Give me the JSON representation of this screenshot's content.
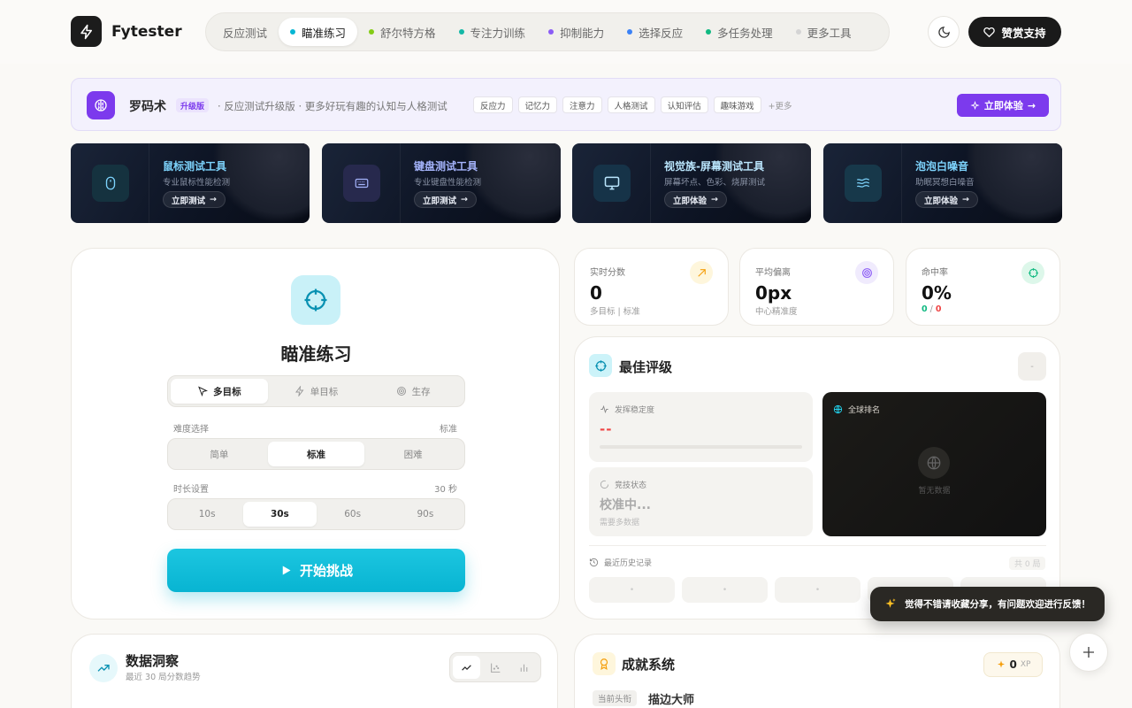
{
  "app": {
    "name": "Fytester"
  },
  "nav": [
    {
      "label": "反应测试",
      "dot": ""
    },
    {
      "label": "瞄准练习",
      "dot": "#06b6d4",
      "active": true
    },
    {
      "label": "舒尔特方格",
      "dot": "#84cc16"
    },
    {
      "label": "专注力训练",
      "dot": "#14b8a6"
    },
    {
      "label": "抑制能力",
      "dot": "#8b5cf6"
    },
    {
      "label": "选择反应",
      "dot": "#3b82f6"
    },
    {
      "label": "多任务处理",
      "dot": "#10b981"
    },
    {
      "label": "更多工具",
      "dot": "#d4d4d4"
    }
  ],
  "header": {
    "support_label": "赞赏支持"
  },
  "banner": {
    "title": "罗码术",
    "badge": "升级版",
    "desc": "· 反应测试升级版 · 更多好玩有趣的认知与人格测试",
    "tags": [
      "反应力",
      "记忆力",
      "注意力",
      "人格测试",
      "认知评估",
      "趣味游戏"
    ],
    "more": "+更多",
    "cta": "立即体验"
  },
  "tools": [
    {
      "title": "鼠标测试工具",
      "desc": "专业鼠标性能检测",
      "btn": "立即测试",
      "color": "#7dd3fc",
      "icon": "mouse-icon"
    },
    {
      "title": "键盘测试工具",
      "desc": "专业键盘性能检测",
      "btn": "立即测试",
      "color": "#a5b4fc",
      "icon": "keyboard-icon"
    },
    {
      "title": "视觉族-屏幕测试工具",
      "desc": "屏幕坏点、色彩、烧屏测试",
      "btn": "立即体验",
      "color": "#bae6fd",
      "icon": "monitor-icon"
    },
    {
      "title": "泡泡白噪音",
      "desc": "助眠冥想白噪音",
      "btn": "立即体验",
      "color": "#7dd3fc",
      "icon": "waves-icon"
    }
  ],
  "game": {
    "title": "瞄准练习",
    "modes": [
      "多目标",
      "单目标",
      "生存"
    ],
    "difficulty_label": "难度选择",
    "difficulty_value": "标准",
    "difficulties": [
      "简单",
      "标准",
      "困难"
    ],
    "duration_label": "时长设置",
    "duration_value": "30 秒",
    "durations": [
      "10s",
      "30s",
      "60s",
      "90s"
    ],
    "start_label": "开始挑战"
  },
  "stats": [
    {
      "label": "实时分数",
      "value": "0",
      "sub": "多目标 | 标准"
    },
    {
      "label": "平均偏离",
      "value": "0px",
      "sub": "中心精准度"
    },
    {
      "label": "命中率",
      "value": "0%",
      "sub_hit": "0",
      "sub_sep": "/",
      "sub_miss": "0"
    }
  ],
  "best": {
    "title": "最佳评级",
    "btn": "-",
    "stability_label": "发挥稳定度",
    "stability_value": "--",
    "state_label": "竞技状态",
    "state_value": "校准中...",
    "state_sub": "需要多数据",
    "rank_label": "全球排名",
    "rank_empty": "暂无数据",
    "history_label": "最近历史记录",
    "history_count": "共 0 局",
    "history": [
      "•",
      "•",
      "•",
      "•",
      "•"
    ]
  },
  "insight": {
    "title": "数据洞察",
    "sub": "最近 30 局分数趋势"
  },
  "achievement": {
    "title": "成就系统",
    "xp": "0",
    "xp_unit": "XP",
    "current_label": "当前头衔",
    "current_value": "描边大师"
  },
  "toast": "觉得不错请收藏分享，有问题欢迎进行反馈！"
}
